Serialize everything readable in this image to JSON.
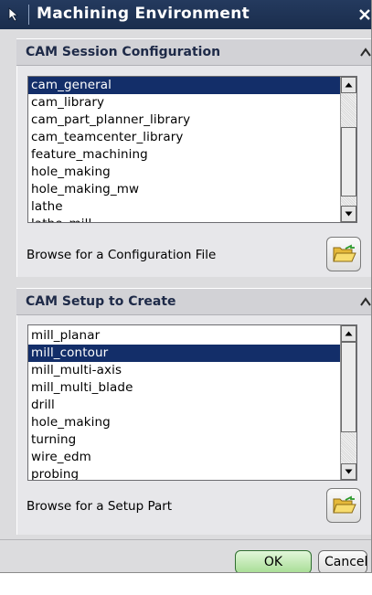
{
  "window": {
    "title": "Machining Environment",
    "icons": [
      "pointer-arrow-icon",
      "close-icon"
    ]
  },
  "session_group": {
    "header": "CAM Session Configuration",
    "items": [
      "cam_general",
      "cam_library",
      "cam_part_planner_library",
      "cam_teamcenter_library",
      "feature_machining",
      "hole_making",
      "hole_making_mw",
      "lathe",
      "lathe_mill"
    ],
    "selected": "cam_general",
    "browse_label": "Browse for a Configuration File",
    "browse_icon": "open-folder-icon"
  },
  "setup_group": {
    "header": "CAM Setup to Create",
    "items": [
      "mill_planar",
      "mill_contour",
      "mill_multi-axis",
      "mill_multi_blade",
      "drill",
      "hole_making",
      "turning",
      "wire_edm",
      "probing"
    ],
    "selected": "mill_contour",
    "browse_label": "Browse for a Setup Part",
    "browse_icon": "open-folder-icon"
  },
  "buttons": {
    "ok": "OK",
    "cancel": "Cancel"
  },
  "colors": {
    "titlebar": "#1f3354",
    "selection": "#132e69",
    "ok_button": "#a7dd95"
  }
}
